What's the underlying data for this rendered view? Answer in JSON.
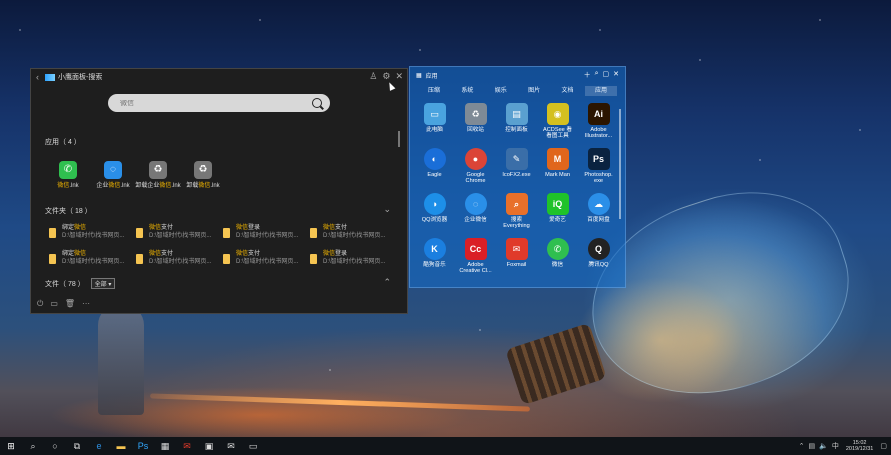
{
  "search_window": {
    "title": "小鹰面板-搜索",
    "search_placeholder": "微信",
    "apps_header": "应用（ 4 ）",
    "apps": [
      {
        "prefix": "",
        "hl": "微信",
        "suffix": ".lnk",
        "icon": "wechat-icon",
        "color": "#2fbf4f"
      },
      {
        "prefix": "企业",
        "hl": "微信",
        "suffix": ".lnk",
        "icon": "wework-icon",
        "color": "#2a8fe8"
      },
      {
        "prefix": "卸载企业",
        "hl": "微信",
        "suffix": ".lnk",
        "icon": "recycle-bin-icon",
        "color": "#777"
      },
      {
        "prefix": "卸载",
        "hl": "微信",
        "suffix": ".lnk",
        "icon": "recycle-bin-icon",
        "color": "#777"
      }
    ],
    "folders_header": "文件夹（ 18 ）",
    "folders": [
      {
        "prefix": "绑定",
        "hl": "微信",
        "suffix": "",
        "path": "D:\\智域时代\\找书网页..."
      },
      {
        "prefix": "",
        "hl": "微信",
        "suffix": "支付",
        "path": "D:\\智域时代\\找书网页..."
      },
      {
        "prefix": "",
        "hl": "微信",
        "suffix": "登录",
        "path": "D:\\智域时代\\找书网页..."
      },
      {
        "prefix": "",
        "hl": "微信",
        "suffix": "支付",
        "path": "D:\\智域时代\\找书网页..."
      },
      {
        "prefix": "绑定",
        "hl": "微信",
        "suffix": "",
        "path": "D:\\智域时代\\找书网页..."
      },
      {
        "prefix": "",
        "hl": "微信",
        "suffix": "支付",
        "path": "D:\\智域时代\\找书网页..."
      },
      {
        "prefix": "",
        "hl": "微信",
        "suffix": "支付",
        "path": "D:\\智域时代\\找书网页..."
      },
      {
        "prefix": "",
        "hl": "微信",
        "suffix": "登录",
        "path": "D:\\智域时代\\找书网页..."
      }
    ],
    "files_header": "文件（ 78 ）",
    "files_filter": "全部"
  },
  "apps_window": {
    "title": "应用",
    "tabs": [
      "压缩",
      "系统",
      "娱乐",
      "图片",
      "文档",
      "应用"
    ],
    "active_tab": 5,
    "items": [
      {
        "label": "此电脑",
        "icon": "computer-icon",
        "color": "#4aa3df",
        "glyph": "▭"
      },
      {
        "label": "回收站",
        "icon": "recycle-bin-icon",
        "color": "#7e8a96",
        "glyph": "♻"
      },
      {
        "label": "控制面板",
        "icon": "control-panel-icon",
        "color": "#5aa0d0",
        "glyph": "▤"
      },
      {
        "label": "ACDSee 看\n看图工具",
        "icon": "acdsee-icon",
        "color": "#d4c020",
        "glyph": "◉"
      },
      {
        "label": "Adobe\nIllustrator...",
        "icon": "illustrator-icon",
        "color": "#2b1500",
        "glyph": "Ai"
      },
      {
        "label": "Eagle",
        "icon": "eagle-icon",
        "color": "#1a6ed8",
        "glyph": "◐"
      },
      {
        "label": "Google\nChrome",
        "icon": "chrome-icon",
        "color": "#db4437",
        "glyph": "●"
      },
      {
        "label": "IcoFX2.exe",
        "icon": "icofx-icon",
        "color": "#3a6ea8",
        "glyph": "✎"
      },
      {
        "label": "Mark Man",
        "icon": "markman-icon",
        "color": "#e0661c",
        "glyph": "M"
      },
      {
        "label": "Photoshop.\nexe",
        "icon": "photoshop-icon",
        "color": "#0a2340",
        "glyph": "Ps"
      },
      {
        "label": "QQ浏览器",
        "icon": "qq-browser-icon",
        "color": "#1d8fe8",
        "glyph": "◑"
      },
      {
        "label": "企业微信",
        "icon": "wework-icon",
        "color": "#2a8fe8",
        "glyph": "◌"
      },
      {
        "label": "搜索\nEverything",
        "icon": "everything-icon",
        "color": "#e8702a",
        "glyph": "⌕"
      },
      {
        "label": "爱奇艺",
        "icon": "iqiyi-icon",
        "color": "#1fc22a",
        "glyph": "iQ"
      },
      {
        "label": "百度网盘",
        "icon": "baidu-netdisk-icon",
        "color": "#2b8fe8",
        "glyph": "☁"
      },
      {
        "label": "酷狗音乐",
        "icon": "kugou-icon",
        "color": "#1b7fe0",
        "glyph": "K"
      },
      {
        "label": "Adobe\nCreative Cl...",
        "icon": "creative-cloud-icon",
        "color": "#da1f26",
        "glyph": "Cc"
      },
      {
        "label": "Foxmail",
        "icon": "foxmail-icon",
        "color": "#e03a2a",
        "glyph": "✉"
      },
      {
        "label": "微信",
        "icon": "wechat-icon",
        "color": "#2fbf4f",
        "glyph": "✆"
      },
      {
        "label": "腾讯QQ",
        "icon": "qq-icon",
        "color": "#222",
        "glyph": "Q"
      }
    ]
  },
  "taskbar": {
    "time": "15:02",
    "date": "2019/12/31"
  }
}
